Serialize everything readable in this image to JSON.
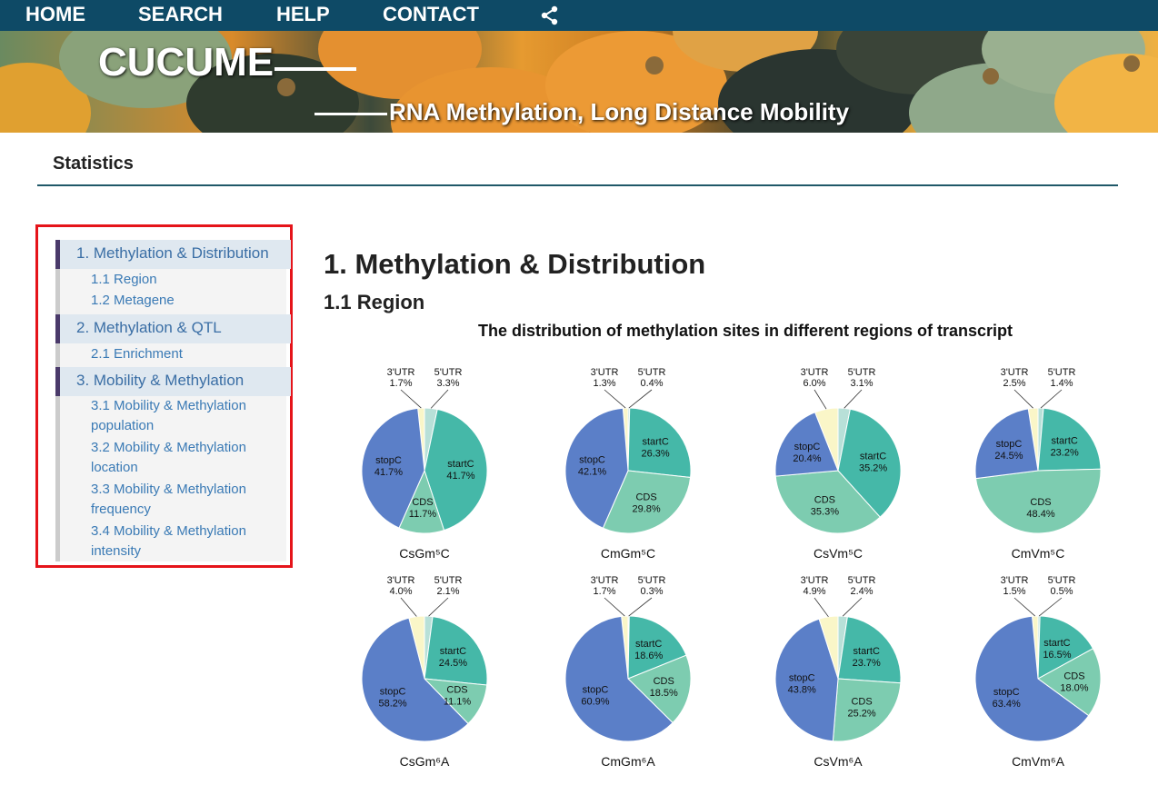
{
  "nav": {
    "home": "HOME",
    "search": "SEARCH",
    "help": "HELP",
    "contact": "CONTACT",
    "share_icon": "share-icon"
  },
  "banner": {
    "brand": "CUCUME",
    "tagline": "RNA Methylation, Long Distance Mobility"
  },
  "page": {
    "title": "Statistics"
  },
  "sidebar": {
    "sections": [
      {
        "label": "1. Methylation & Distribution",
        "items": [
          "1.1 Region",
          "1.2 Metagene"
        ]
      },
      {
        "label": "2. Methylation & QTL",
        "items": [
          "2.1 Enrichment"
        ]
      },
      {
        "label": "3. Mobility & Methylation",
        "items": [
          "3.1 Mobility & Methylation population",
          "3.2 Mobility & Methylation location",
          "3.3 Mobility & Methylation frequency",
          "3.4 Mobility & Methylation intensity"
        ]
      }
    ]
  },
  "main": {
    "heading": "1. Methylation & Distribution",
    "subheading": "1.1 Region"
  },
  "colors": {
    "stopC": "#5b7fc8",
    "CDS": "#7dccb0",
    "startC": "#45b8a8",
    "5UTR": "#b8e0d8",
    "3UTR": "#faf6c8",
    "nav_bg": "#0e4a66",
    "link": "#3a7ab5"
  },
  "chart_data": {
    "type": "pie",
    "title": "The distribution of methylation sites in different regions of transcript",
    "categories": [
      "3'UTR",
      "5'UTR",
      "startC",
      "CDS",
      "stopC"
    ],
    "charts": [
      {
        "name": "CsGm⁵C",
        "values": [
          1.7,
          3.3,
          41.7,
          11.7,
          41.7
        ]
      },
      {
        "name": "CmGm⁵C",
        "values": [
          1.3,
          0.4,
          26.3,
          29.8,
          42.1
        ]
      },
      {
        "name": "CsVm⁵C",
        "values": [
          6.0,
          3.1,
          35.2,
          35.3,
          20.4
        ]
      },
      {
        "name": "CmVm⁵C",
        "values": [
          2.5,
          1.4,
          23.2,
          48.4,
          24.5
        ]
      },
      {
        "name": "CsGm⁶A",
        "values": [
          4.0,
          2.1,
          24.5,
          11.1,
          58.2
        ]
      },
      {
        "name": "CmGm⁶A",
        "values": [
          1.7,
          0.3,
          18.6,
          18.5,
          60.9
        ]
      },
      {
        "name": "CsVm⁶A",
        "values": [
          4.9,
          2.4,
          23.7,
          25.2,
          43.8
        ]
      },
      {
        "name": "CmVm⁶A",
        "values": [
          1.5,
          0.5,
          16.5,
          18.0,
          63.4
        ]
      }
    ]
  }
}
